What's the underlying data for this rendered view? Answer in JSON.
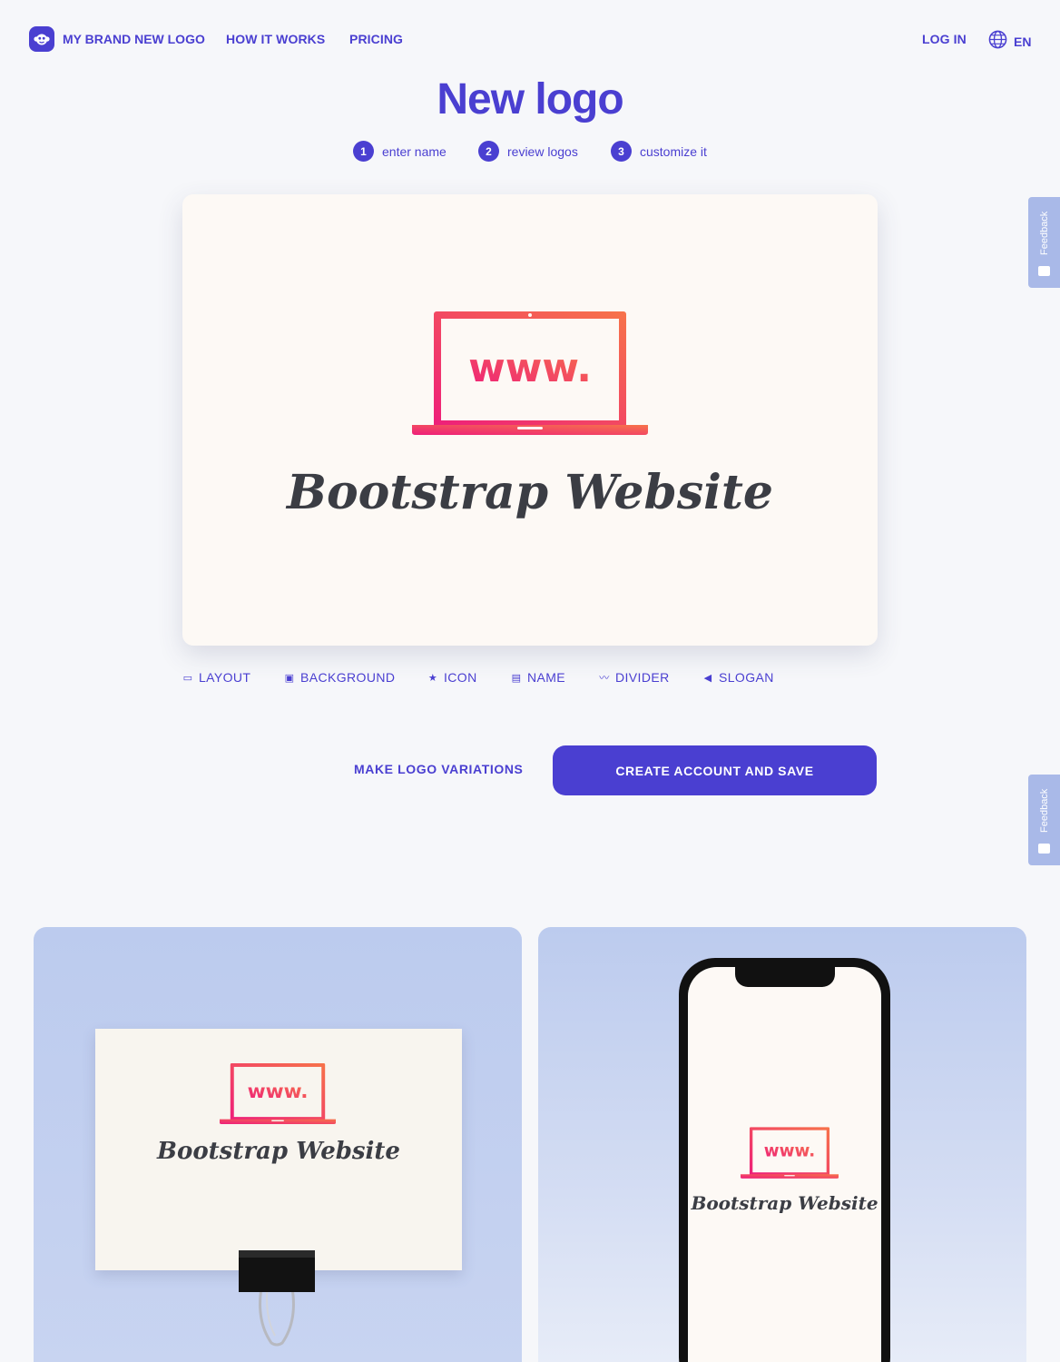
{
  "header": {
    "brand": "MY BRAND NEW LOGO",
    "nav": [
      "HOW IT WORKS",
      "PRICING"
    ],
    "login": "LOG IN",
    "language": "EN"
  },
  "title": "New logo",
  "steps": [
    {
      "num": "1",
      "label": "enter name"
    },
    {
      "num": "2",
      "label": "review logos"
    },
    {
      "num": "3",
      "label": "customize it"
    }
  ],
  "logo": {
    "icon_text": "www.",
    "name": "Bootstrap Website",
    "colors": {
      "gradient_start": "#ee1e7a",
      "gradient_end": "#f7734a",
      "text": "#3b3d44",
      "background": "#fdf9f5"
    }
  },
  "tools": [
    "LAYOUT",
    "BACKGROUND",
    "ICON",
    "NAME",
    "DIVIDER",
    "SLOGAN"
  ],
  "actions": {
    "variations": "MAKE LOGO VARIATIONS",
    "save": "CREATE ACCOUNT AND SAVE"
  },
  "feedback_label": "Feedback",
  "accent_color": "#4a3fd1"
}
